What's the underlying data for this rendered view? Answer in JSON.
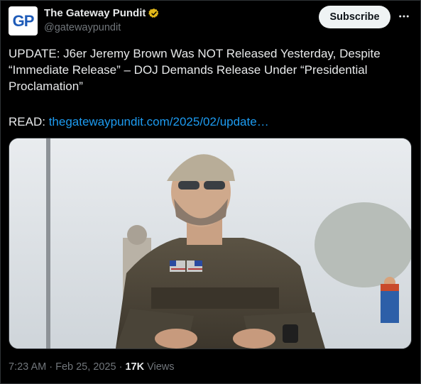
{
  "author": {
    "avatar_text": "GP",
    "display_name": "The Gateway Pundit",
    "handle": "@gatewaypundit",
    "verified_badge": "gold-check-icon"
  },
  "actions": {
    "subscribe_label": "Subscribe",
    "more_icon": "more-horizontal-icon"
  },
  "tweet": {
    "text": "UPDATE: J6er Jeremy Brown Was NOT Released Yesterday, Despite “Immediate Release” – DOJ Demands Release Under “Presidential Proclamation”",
    "read_prefix": "READ: ",
    "link_text": "thegatewaypundit.com/2025/02/update…"
  },
  "media": {
    "description_icon": "photo"
  },
  "meta": {
    "time": "7:23 AM",
    "sep": " · ",
    "date": "Feb 25, 2025",
    "sep2": " · ",
    "views_count": "17K",
    "views_label": " Views"
  },
  "colors": {
    "background": "#000000",
    "text": "#e7e9ea",
    "muted": "#71767b",
    "link": "#1d9bf0",
    "badge": "#e2b719"
  }
}
